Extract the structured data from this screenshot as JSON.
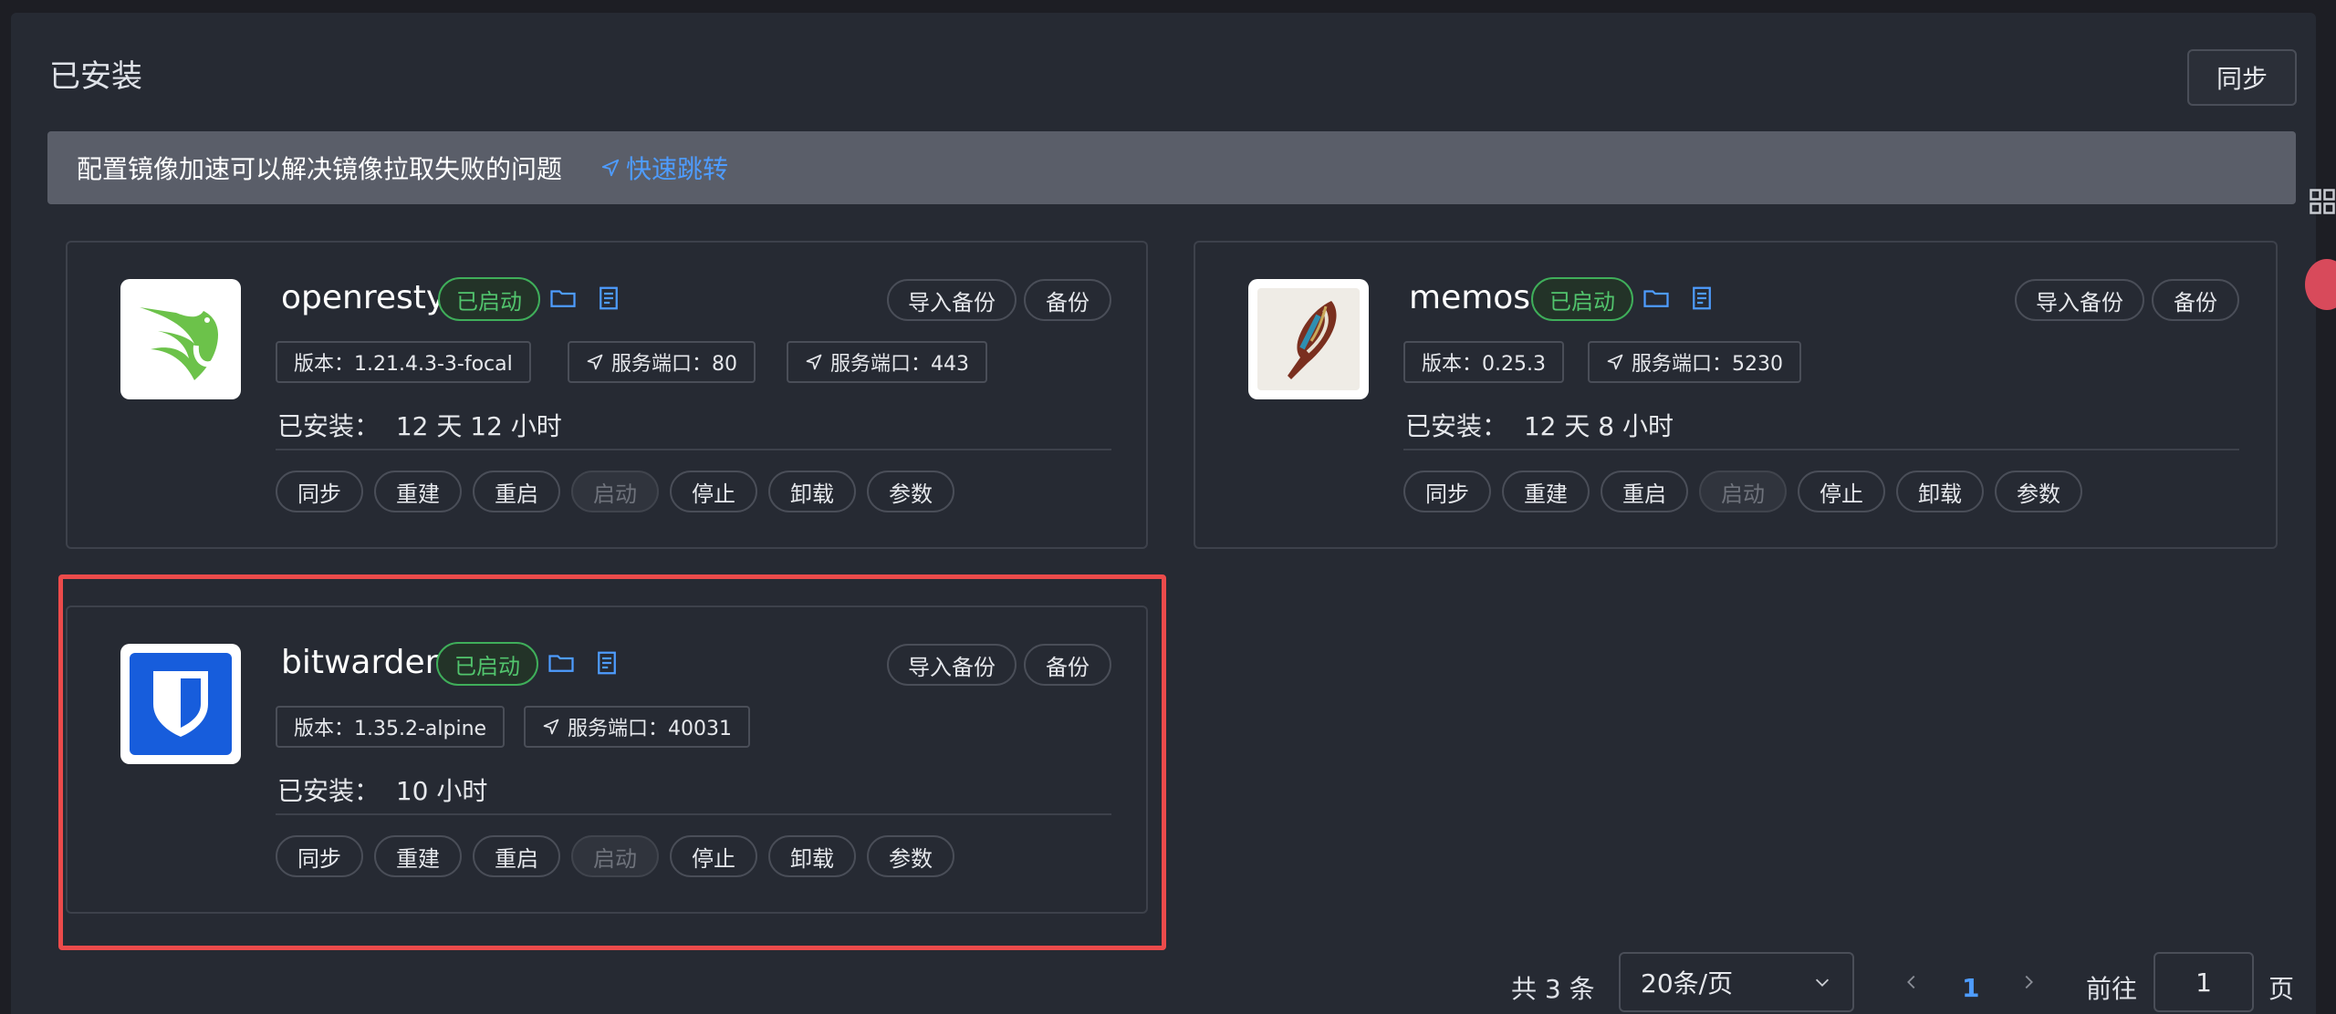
{
  "page": {
    "title": "已安装",
    "sync_button": "同步"
  },
  "alert": {
    "text": "配置镜像加速可以解决镜像拉取失败的问题",
    "link": "快速跳转"
  },
  "apps": [
    {
      "name": "openresty",
      "status": "已启动",
      "import_backup": "导入备份",
      "backup": "备份",
      "version": "版本：1.21.4.3-3-focal",
      "ports": [
        "服务端口：80",
        "服务端口：443"
      ],
      "installed_label": "已安装：",
      "installed_time": "12 天 12 小时",
      "actions": [
        "同步",
        "重建",
        "重启",
        "启动",
        "停止",
        "卸载",
        "参数"
      ]
    },
    {
      "name": "memos",
      "status": "已启动",
      "import_backup": "导入备份",
      "backup": "备份",
      "version": "版本：0.25.3",
      "ports": [
        "服务端口：5230"
      ],
      "installed_label": "已安装：",
      "installed_time": "12 天 8 小时",
      "actions": [
        "同步",
        "重建",
        "重启",
        "启动",
        "停止",
        "卸载",
        "参数"
      ]
    },
    {
      "name": "bitwarden",
      "status": "已启动",
      "import_backup": "导入备份",
      "backup": "备份",
      "version": "版本：1.35.2-alpine",
      "ports": [
        "服务端口：40031"
      ],
      "installed_label": "已安装：",
      "installed_time": "10 小时",
      "actions": [
        "同步",
        "重建",
        "重启",
        "启动",
        "停止",
        "卸载",
        "参数"
      ]
    }
  ],
  "pagination": {
    "total": "共 3 条",
    "page_size": "20条/页",
    "current_page": "1",
    "goto_label": "前往",
    "goto_value": "1",
    "page_suffix": "页"
  },
  "colors": {
    "accent": "#4e9cff",
    "running": "#52c46d",
    "highlight": "#ec4b4b"
  }
}
